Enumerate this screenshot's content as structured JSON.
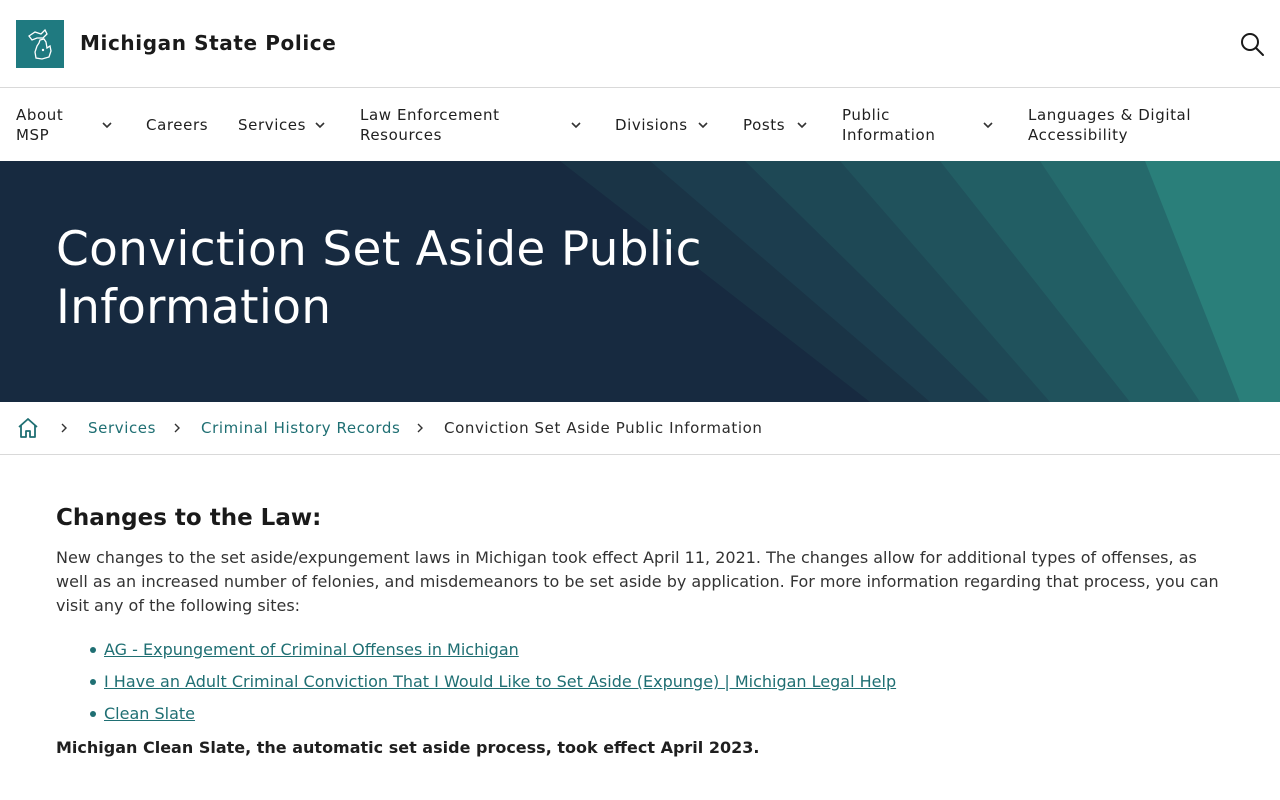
{
  "header": {
    "logo_icon": "michigan-map-icon",
    "site_title": "Michigan State Police",
    "search_icon": "search-icon"
  },
  "nav": {
    "items": [
      {
        "label": "About MSP",
        "dropdown": true
      },
      {
        "label": "Careers",
        "dropdown": false
      },
      {
        "label": "Services",
        "dropdown": true
      },
      {
        "label": "Law Enforcement Resources",
        "dropdown": true
      },
      {
        "label": "Divisions",
        "dropdown": true
      },
      {
        "label": "Posts",
        "dropdown": true
      },
      {
        "label": "Public Information",
        "dropdown": true
      },
      {
        "label": "Languages & Digital Accessibility",
        "dropdown": false
      }
    ]
  },
  "hero": {
    "title": "Conviction Set Aside Public Information",
    "background_color": "#172a40",
    "accent_color": "#2a7f7a"
  },
  "breadcrumb": {
    "home_icon": "home-icon",
    "items": [
      {
        "label": "Services"
      },
      {
        "label": "Criminal History Records"
      }
    ],
    "current": "Conviction Set Aside Public Information"
  },
  "content": {
    "heading": "Changes to the Law:",
    "paragraph": "New changes to the set aside/expungement laws in Michigan took effect April 11, 2021. The changes allow for additional types of offenses, as well as an increased number of felonies, and misdemeanors to be set aside by application.  For more information regarding that process, you can visit any of the following sites:",
    "links": [
      {
        "label": "AG - Expungement of Criminal Offenses in Michigan"
      },
      {
        "label": "I Have an Adult Criminal Conviction That I Would Like to Set Aside (Expunge) | Michigan Legal Help"
      },
      {
        "label": "Clean Slate"
      }
    ],
    "note": "Michigan Clean Slate, the automatic set aside process, took effect April 2023."
  },
  "colors": {
    "link": "#1f6f73",
    "logo_bg": "#1f7a80"
  }
}
